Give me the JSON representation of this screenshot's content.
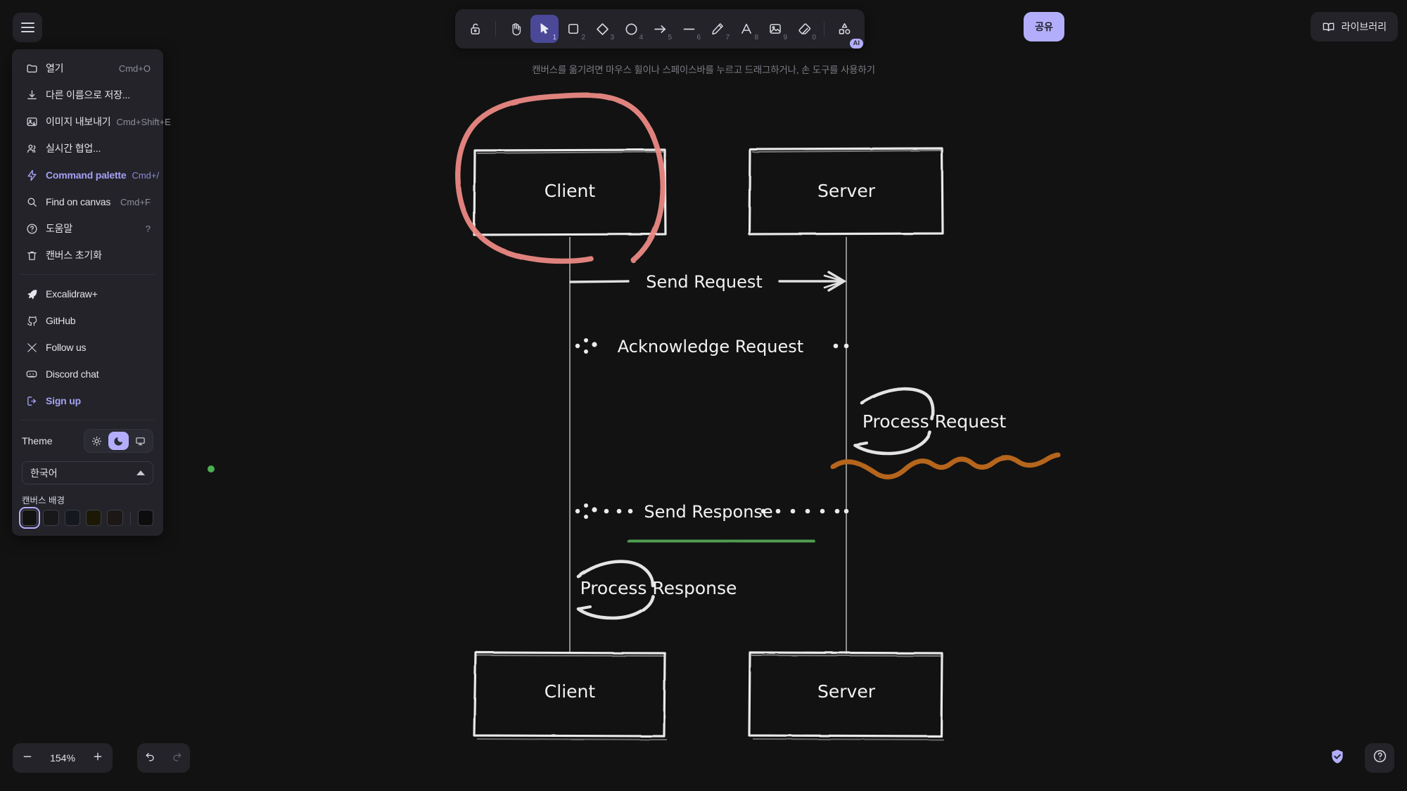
{
  "app": {
    "zoom_level": "154%",
    "canvas_hint": "캔버스를 옮기려면 마우스 휠이나 스페이스바를 누르고 드래그하거나, 손 도구를 사용하기"
  },
  "top_right": {
    "share_label": "공유",
    "library_label": "라이브러리",
    "library_icon": "book-icon"
  },
  "hamburger": {
    "icon": "hamburger-menu-icon"
  },
  "menu": {
    "items": [
      {
        "label": "열기",
        "shortcut": "Cmd+O",
        "icon": "folder-icon",
        "accent": false
      },
      {
        "label": "다른 이름으로 저장...",
        "shortcut": "",
        "icon": "save-as-icon",
        "accent": false
      },
      {
        "label": "이미지 내보내기",
        "shortcut": "Cmd+Shift+E",
        "icon": "export-image-icon",
        "accent": false
      },
      {
        "label": "실시간 협업...",
        "shortcut": "",
        "icon": "people-icon",
        "accent": false
      },
      {
        "label": "Command palette",
        "shortcut": "Cmd+/",
        "icon": "bolt-icon",
        "accent": true
      },
      {
        "label": "Find on canvas",
        "shortcut": "Cmd+F",
        "icon": "search-icon",
        "accent": false
      },
      {
        "label": "도움말",
        "shortcut": "?",
        "icon": "help-circle-icon",
        "accent": false
      },
      {
        "label": "캔버스 초기화",
        "shortcut": "",
        "icon": "trash-icon",
        "accent": false
      }
    ],
    "social": [
      {
        "label": "Excalidraw+",
        "icon": "rocket-icon",
        "accent": false
      },
      {
        "label": "GitHub",
        "icon": "github-icon",
        "accent": false
      },
      {
        "label": "Follow us",
        "icon": "x-twitter-icon",
        "accent": false
      },
      {
        "label": "Discord chat",
        "icon": "discord-icon",
        "accent": false
      },
      {
        "label": "Sign up",
        "icon": "sign-up-icon",
        "accent": true
      }
    ],
    "theme": {
      "label": "Theme",
      "options": [
        "light",
        "dark",
        "system"
      ],
      "selected": "dark"
    },
    "language": {
      "selected": "한국어"
    },
    "canvas_background": {
      "label": "캔버스 배경",
      "colors": [
        "#121212",
        "#161618",
        "#13171c",
        "#181605",
        "#1b1514",
        "#0e0e0e"
      ],
      "selected_index": 0
    }
  },
  "toolbar": {
    "tools": [
      {
        "name": "lock",
        "icon": "lock-icon",
        "num": "",
        "active": false
      },
      {
        "name": "hand",
        "icon": "hand-icon",
        "num": "",
        "active": false
      },
      {
        "name": "selection",
        "icon": "cursor-icon",
        "num": "1",
        "active": true
      },
      {
        "name": "rectangle",
        "icon": "square-icon",
        "num": "2",
        "active": false
      },
      {
        "name": "diamond",
        "icon": "diamond-icon",
        "num": "3",
        "active": false
      },
      {
        "name": "ellipse",
        "icon": "circle-icon",
        "num": "4",
        "active": false
      },
      {
        "name": "arrow",
        "icon": "arrow-icon",
        "num": "5",
        "active": false
      },
      {
        "name": "line",
        "icon": "line-icon",
        "num": "6",
        "active": false
      },
      {
        "name": "draw",
        "icon": "pencil-icon",
        "num": "7",
        "active": false
      },
      {
        "name": "text",
        "icon": "text-a-icon",
        "num": "8",
        "active": false
      },
      {
        "name": "image",
        "icon": "image-icon",
        "num": "9",
        "active": false
      },
      {
        "name": "eraser",
        "icon": "eraser-icon",
        "num": "0",
        "active": false
      },
      {
        "name": "frame-ai",
        "icon": "shapes-ai-icon",
        "num": "",
        "active": false,
        "badge": "AI"
      }
    ]
  },
  "bottom_bar": {
    "zoom_out": "zoom-out-icon",
    "zoom_in": "zoom-in-icon",
    "undo": "undo-icon",
    "redo": "redo-icon",
    "shield": "shield-check-icon",
    "help": "help-circle-icon"
  },
  "diagram": {
    "title": "Client-Server sequence diagram",
    "nodes": [
      {
        "label": "Client",
        "position": "top-left"
      },
      {
        "label": "Server",
        "position": "top-right"
      },
      {
        "label": "Client",
        "position": "bottom-left"
      },
      {
        "label": "Server",
        "position": "bottom-right"
      }
    ],
    "messages": [
      {
        "label": "Send Request",
        "style": "solid",
        "direction": "client-to-server"
      },
      {
        "label": "Acknowledge Request",
        "style": "dotted",
        "direction": "server-to-client"
      },
      {
        "label": "Process Request",
        "style": "self-loop",
        "actor": "server"
      },
      {
        "label": "Send Response",
        "style": "dotted",
        "direction": "server-to-client"
      },
      {
        "label": "Process Response",
        "style": "self-loop",
        "actor": "client"
      }
    ],
    "annotations": [
      {
        "type": "freedraw-circle",
        "color": "#e8817c",
        "target": "Client top box"
      },
      {
        "type": "freedraw-squiggle",
        "color": "#b5651d",
        "target": "below Process Request"
      },
      {
        "type": "freedraw-underline",
        "color": "#4f9e52",
        "target": "under Send Response"
      }
    ]
  }
}
